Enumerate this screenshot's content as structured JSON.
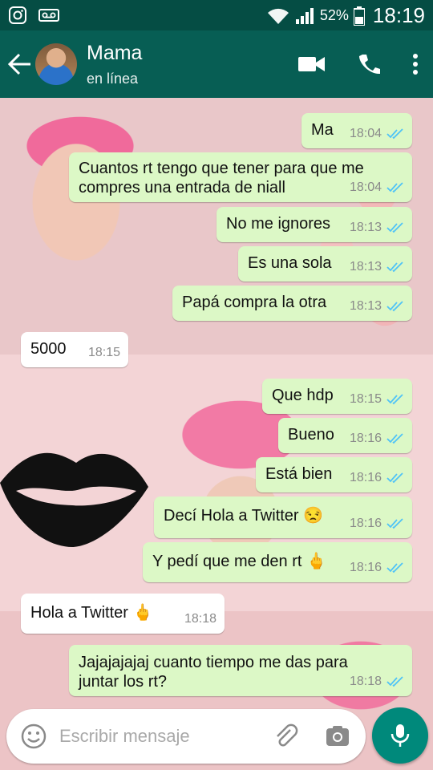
{
  "status_bar": {
    "battery": "52%",
    "time": "18:19"
  },
  "header": {
    "name": "Mama",
    "status": "en línea"
  },
  "messages": [
    {
      "dir": "out",
      "text": "Ma",
      "time": "18:04"
    },
    {
      "dir": "out",
      "lines": [
        "Cuantos rt tengo que tener para que me",
        "compres una entrada de niall"
      ],
      "time": "18:04"
    },
    {
      "dir": "out",
      "text": "No me ignores",
      "time": "18:13"
    },
    {
      "dir": "out",
      "text": "Es una sola",
      "time": "18:13"
    },
    {
      "dir": "out",
      "text": "Papá compra la otra",
      "time": "18:13"
    },
    {
      "dir": "in",
      "text": "5000",
      "time": "18:15"
    },
    {
      "dir": "out",
      "text": "Que hdp",
      "time": "18:15"
    },
    {
      "dir": "out",
      "text": "Bueno",
      "time": "18:16"
    },
    {
      "dir": "out",
      "text": "Está bien",
      "time": "18:16"
    },
    {
      "dir": "out",
      "text": "Decí Hola a Twitter 😒",
      "time": "18:16"
    },
    {
      "dir": "out",
      "text": "Y pedí que me den rt 🖕",
      "time": "18:16"
    },
    {
      "dir": "in",
      "text": "Hola a Twitter 🖕",
      "time": "18:18"
    },
    {
      "dir": "out",
      "lines": [
        "Jajajajajaj cuanto tiempo me das para",
        "juntar los rt?"
      ],
      "time": "18:18"
    }
  ],
  "input": {
    "placeholder": "Escribir mensaje"
  },
  "icons": {
    "back": "arrow-left-icon",
    "video": "video-call-icon",
    "call": "phone-icon",
    "menu": "more-vert-icon",
    "emoji": "emoji-icon",
    "attach": "paperclip-icon",
    "camera": "camera-icon",
    "mic": "microphone-icon"
  },
  "colors": {
    "header": "#075e54",
    "status_bar": "#054d44",
    "outgoing": "#dcf8c6",
    "incoming": "#ffffff",
    "ticks": "#4fc3f7",
    "fab": "#00897b"
  }
}
